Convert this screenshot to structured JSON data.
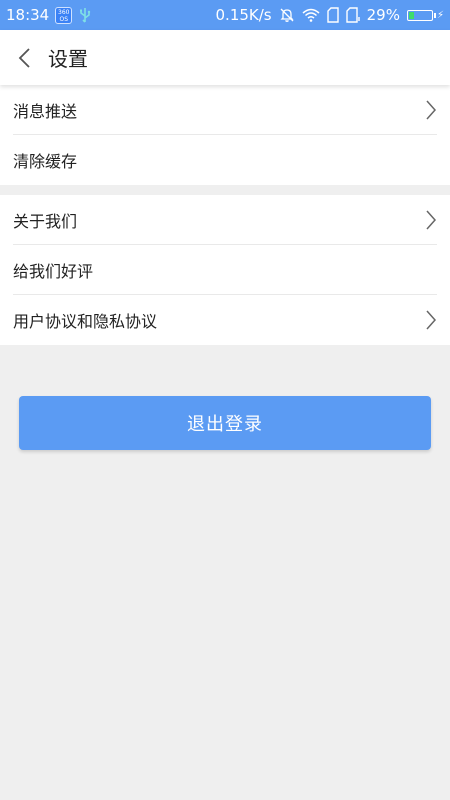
{
  "status_bar": {
    "time": "18:34",
    "os_badge": "360 OS",
    "speed": "0.15K/s",
    "battery": "29%",
    "battery_level": 0.29,
    "icons": [
      "usb-icon",
      "bell-off-icon",
      "wifi-icon",
      "sim-icon",
      "sim-icon",
      "battery-icon"
    ]
  },
  "header": {
    "title": "设置",
    "back_icon": "chevron-left-icon"
  },
  "groups": [
    {
      "items": [
        {
          "label": "消息推送",
          "has_arrow": true
        },
        {
          "label": "清除缓存",
          "has_arrow": false
        }
      ]
    },
    {
      "items": [
        {
          "label": "关于我们",
          "has_arrow": true
        },
        {
          "label": "给我们好评",
          "has_arrow": false
        },
        {
          "label": "用户协议和隐私协议",
          "has_arrow": true
        }
      ]
    }
  ],
  "logout": {
    "label": "退出登录"
  },
  "colors": {
    "accent": "#5b9bf3",
    "background": "#efefef",
    "surface": "#ffffff",
    "divider": "#e9e9e9"
  }
}
